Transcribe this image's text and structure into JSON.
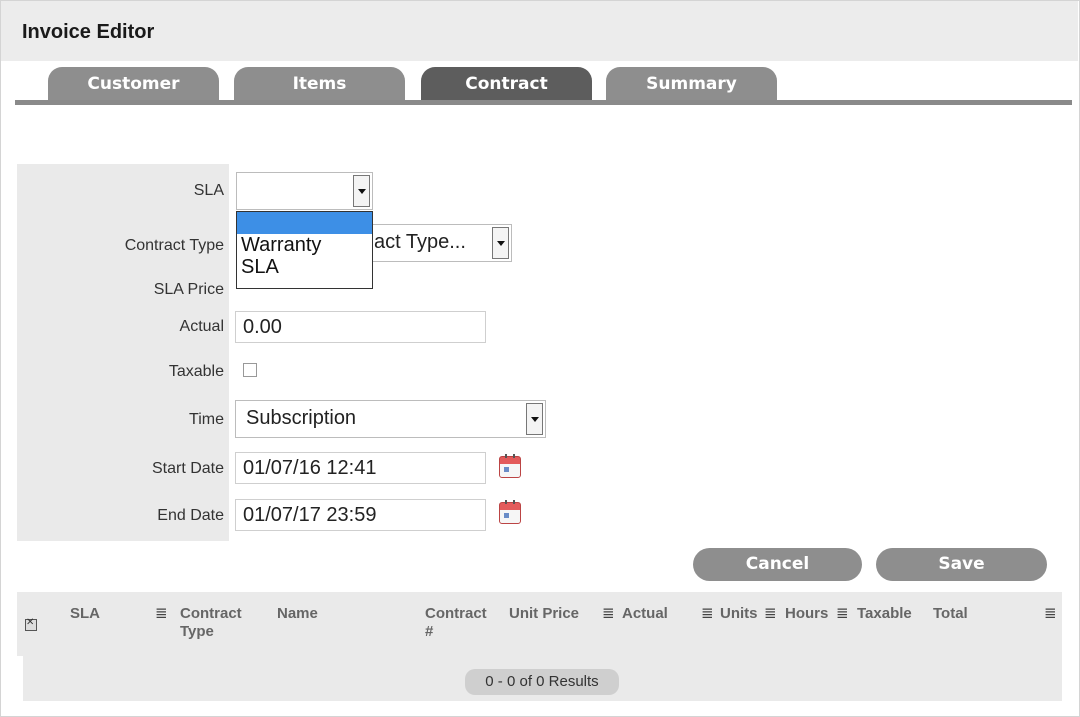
{
  "header": {
    "title": "Invoice Editor"
  },
  "tabs": [
    {
      "label": "Customer",
      "active": false
    },
    {
      "label": "Items",
      "active": false
    },
    {
      "label": "Contract",
      "active": true
    },
    {
      "label": "Summary",
      "active": false
    }
  ],
  "form": {
    "sla": {
      "label": "SLA",
      "value": ""
    },
    "sla_options": [
      "",
      "Warranty",
      "SLA"
    ],
    "contract_type": {
      "label": "Contract Type",
      "visible_value": "act Type..."
    },
    "sla_price": {
      "label": "SLA Price"
    },
    "actual": {
      "label": "Actual",
      "value": "0.00"
    },
    "taxable": {
      "label": "Taxable",
      "checked": false
    },
    "time": {
      "label": "Time",
      "value": "Subscription"
    },
    "start_date": {
      "label": "Start Date",
      "value": "01/07/16 12:41"
    },
    "end_date": {
      "label": "End Date",
      "value": "01/07/17 23:59"
    }
  },
  "buttons": {
    "cancel": "Cancel",
    "save": "Save"
  },
  "grid": {
    "columns": [
      {
        "l1": "SLA",
        "l2": ""
      },
      {
        "l1": "Contract",
        "l2": "Type"
      },
      {
        "l1": "Name",
        "l2": ""
      },
      {
        "l1": "Contract",
        "l2": "#"
      },
      {
        "l1": "Unit Price",
        "l2": ""
      },
      {
        "l1": "Actual",
        "l2": ""
      },
      {
        "l1": "Units",
        "l2": ""
      },
      {
        "l1": "Hours",
        "l2": ""
      },
      {
        "l1": "Taxable",
        "l2": ""
      },
      {
        "l1": "Total",
        "l2": ""
      }
    ],
    "menu_glyph": "≣",
    "results": "0 - 0 of 0 Results"
  },
  "colors": {
    "tab": "#8e8e8e",
    "tab_active": "#5d5d5d",
    "selection": "#3d8fe6",
    "panel": "#eaeaea"
  },
  "icons": [
    "calendar-icon",
    "dropdown-arrow-icon",
    "select-all-icon",
    "column-menu-icon"
  ]
}
